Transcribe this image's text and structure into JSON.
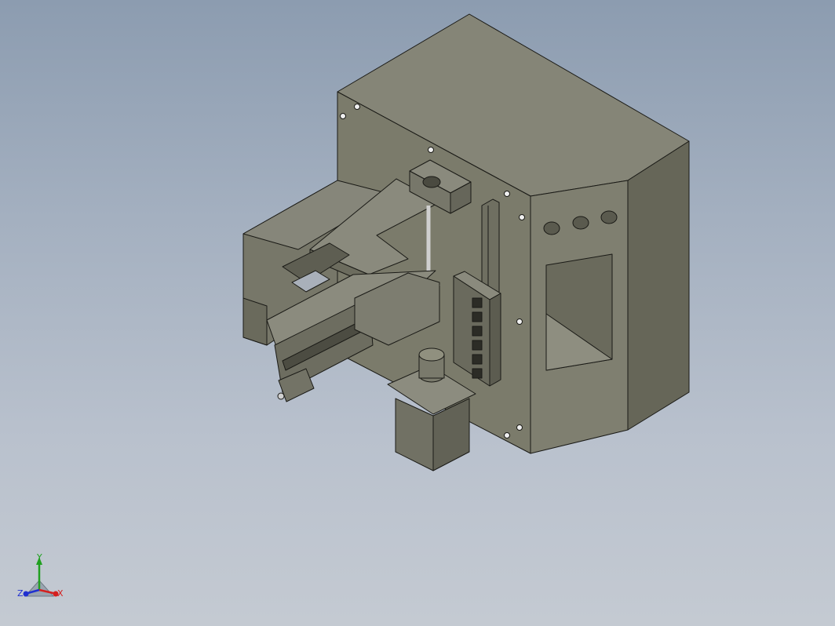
{
  "scene": {
    "type": "isometric-cad-assembly",
    "background_top": "#8c9cb0",
    "background_bottom": "#c4cad2",
    "body_color": "#7b7b6c",
    "body_side_color": "#686859",
    "edge_color": "#1a1a16"
  },
  "triad": {
    "x_label": "X",
    "y_label": "Y",
    "z_label": "Z",
    "x_color": "#d42020",
    "y_color": "#20a020",
    "z_color": "#2030d0"
  }
}
